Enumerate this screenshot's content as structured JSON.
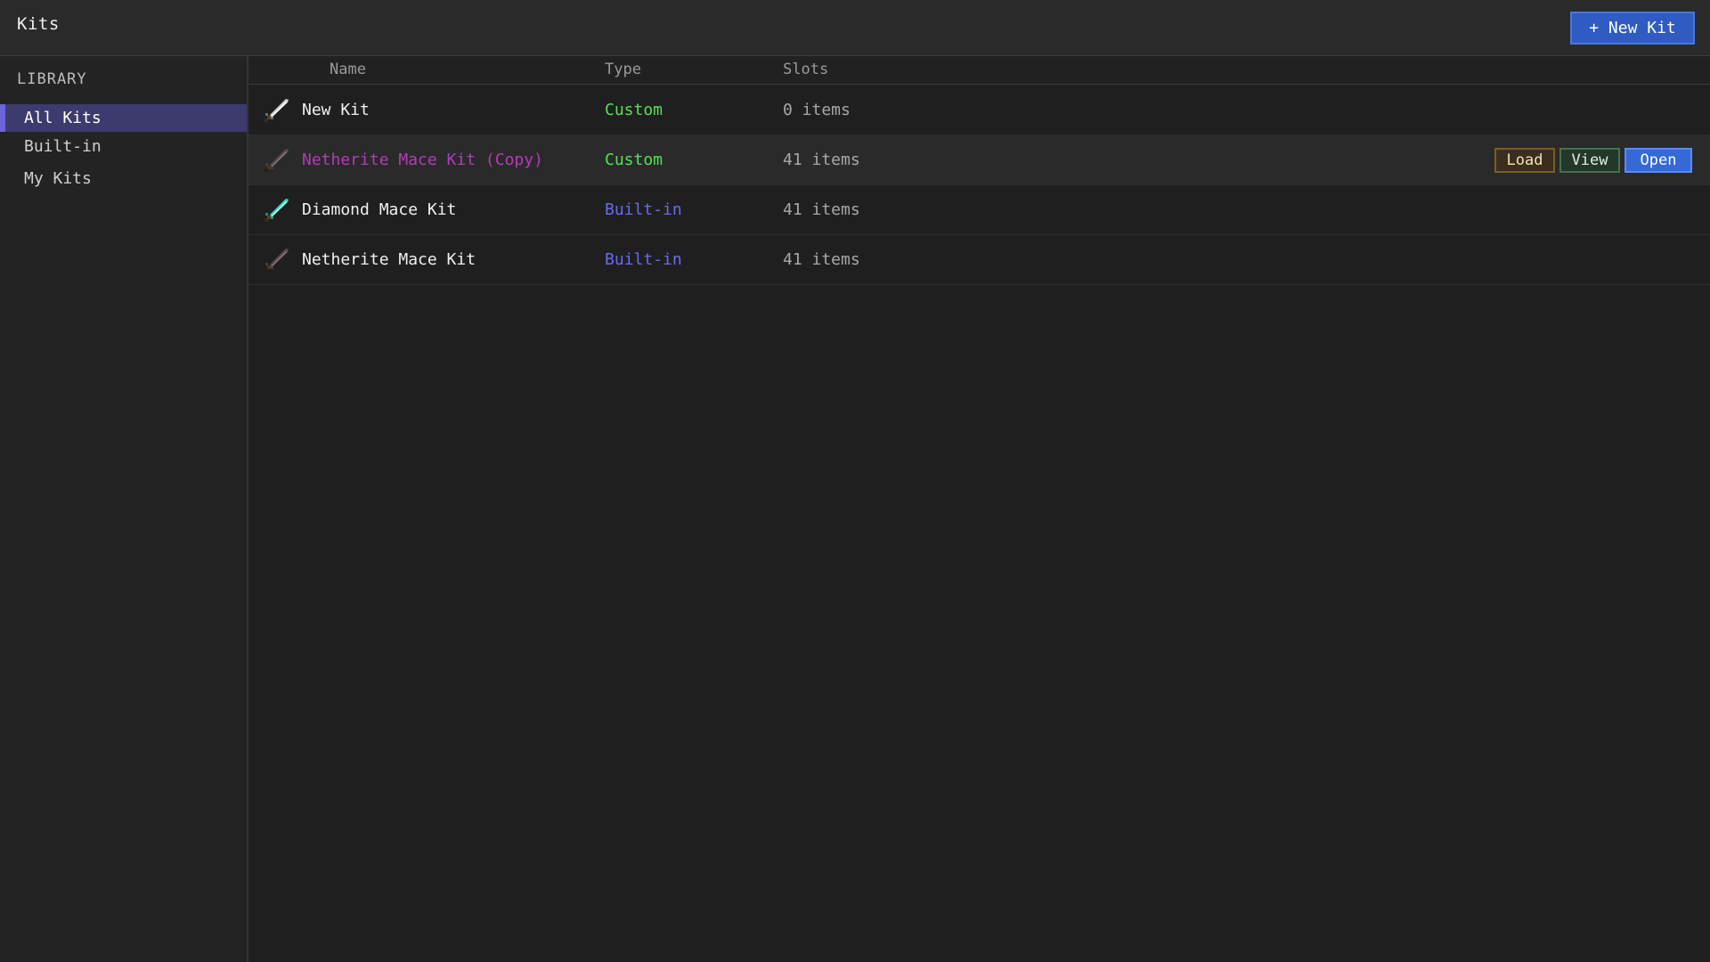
{
  "header": {
    "title": "Kits",
    "new_kit_label": "+ New Kit"
  },
  "sidebar": {
    "section_title": "LIBRARY",
    "items": [
      {
        "label": "All Kits",
        "active": true
      },
      {
        "label": "Built-in",
        "active": false
      },
      {
        "label": "My Kits",
        "active": false
      }
    ]
  },
  "table": {
    "columns": [
      "Name",
      "Type",
      "Slots"
    ],
    "rows": [
      {
        "name": "New Kit",
        "type": "Custom",
        "slots": "0 items",
        "icon": "iron-sword-icon",
        "name_color": "#f0f0f0",
        "type_color": "#55e155"
      },
      {
        "name": "Netherite Mace Kit (Copy)",
        "type": "Custom",
        "slots": "41 items",
        "icon": "netherite-sword-icon",
        "name_color": "#b23cb8",
        "type_color": "#55e155"
      },
      {
        "name": "Diamond Mace Kit",
        "type": "Built-in",
        "slots": "41 items",
        "icon": "diamond-sword-icon",
        "name_color": "#f0f0f0",
        "type_color": "#6a6af0"
      },
      {
        "name": "Netherite Mace Kit",
        "type": "Built-in",
        "slots": "41 items",
        "icon": "netherite-sword-icon",
        "name_color": "#f0f0f0",
        "type_color": "#6a6af0"
      }
    ]
  },
  "row_actions": {
    "load_label": "Load",
    "view_label": "View",
    "open_label": "Open"
  },
  "colors": {
    "accent": "#2f5bc2",
    "active_sidebar": "#3d3a6e",
    "custom_type": "#55e155",
    "builtin_type": "#6a6af0"
  }
}
